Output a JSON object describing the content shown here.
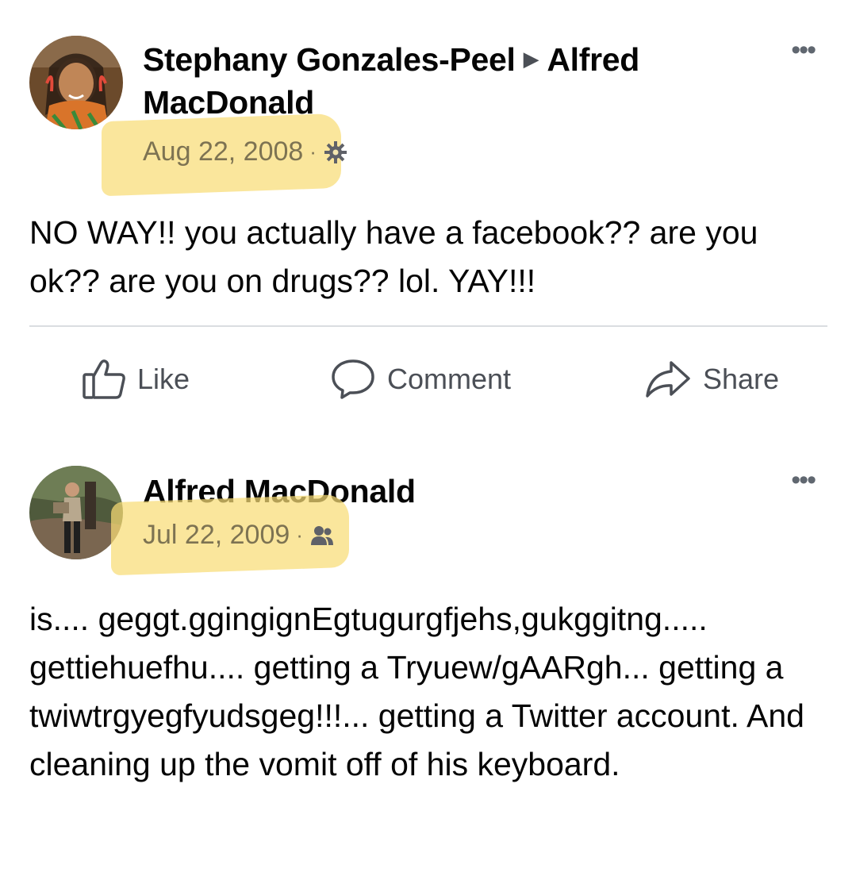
{
  "posts": [
    {
      "author": "Stephany Gonzales-Peel",
      "arrow": "▶",
      "recipient": "Alfred MacDonald",
      "date": "Aug 22, 2008",
      "separator": "·",
      "privacy_icon": "gear-icon",
      "more": "•••",
      "text": "NO WAY!! you actually have a facebook?? are you ok?? are you on drugs?? lol. YAY!!!",
      "actions": {
        "like": "Like",
        "comment": "Comment",
        "share": "Share"
      }
    },
    {
      "author": "Alfred MacDonald",
      "date": "Jul 22, 2009",
      "separator": "·",
      "privacy_icon": "friends-icon",
      "more": "•••",
      "text": "is.... geggt.ggingignEgtugurgfjehs,gukggitng..... gettiehuefhu.... getting a Tryuew/gAARgh... getting a twiwtrgyegfyudsgeg!!!... getting a Twitter account. And cleaning up the vomit off of his keyboard."
    }
  ],
  "colors": {
    "highlight": "#f8dd76",
    "text": "#050505",
    "muted": "#4b4f56",
    "divider": "#dadde1"
  }
}
